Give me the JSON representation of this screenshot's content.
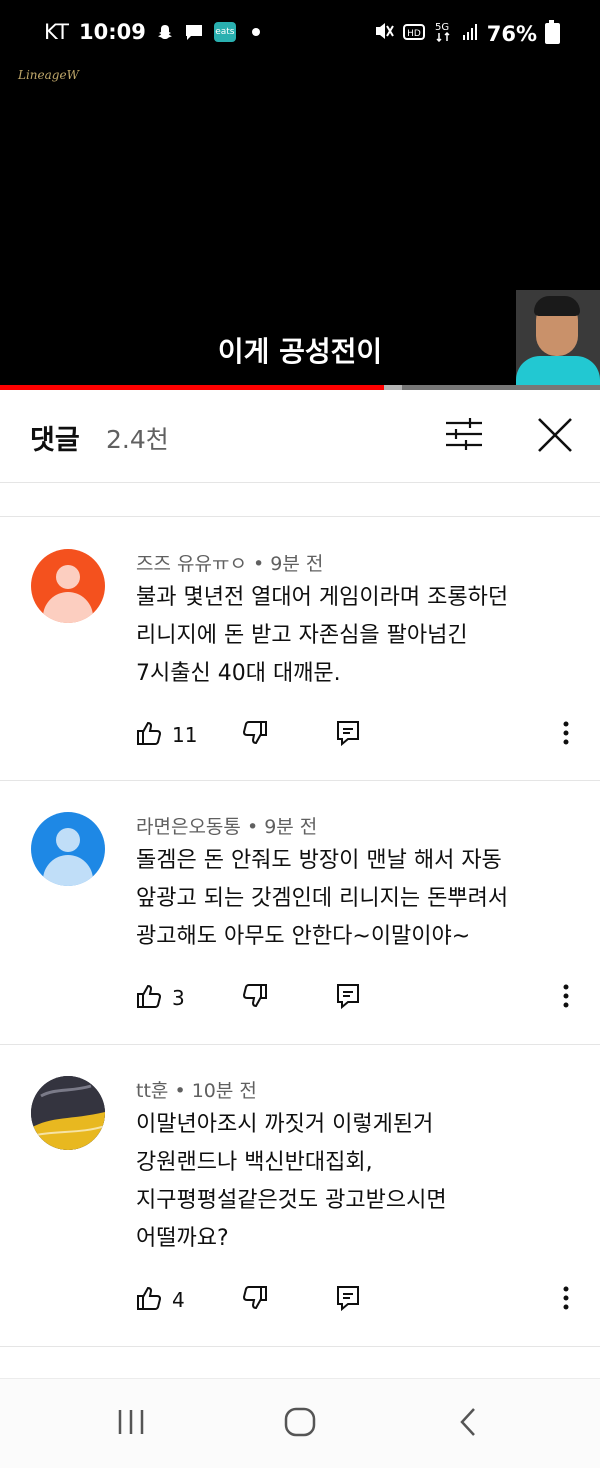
{
  "status_bar": {
    "carrier": "KT",
    "time": "10:09",
    "eats_badge": "eats",
    "battery": "76%"
  },
  "video": {
    "logo": "LineageW",
    "subtitle": "이게 공성전이",
    "progress_percent": 64,
    "buffered_percent": 3
  },
  "comments_header": {
    "title": "댓글",
    "count": "2.4천"
  },
  "comments": [
    {
      "author": "즈즈 유유ㅠㅇ",
      "time": "9분 전",
      "lines": [
        "불과 몇년전 열대어 게임이라며 조롱하던",
        "리니지에 돈 받고 자존심을 팔아넘긴",
        "7시출신 40대 대깨문."
      ],
      "likes": "11",
      "avatar_color": "#f4511e"
    },
    {
      "author": "라면은오동통",
      "time": "9분 전",
      "lines": [
        "돌겜은 돈 안줘도 방장이 맨날 해서 자동",
        "앞광고 되는 갓겜인데 리니지는 돈뿌려서",
        "광고해도 아무도 안한다~이말이야~"
      ],
      "likes": "3",
      "avatar_color": "#1e88e5"
    },
    {
      "author": "tt훈",
      "time": "10분 전",
      "lines": [
        "이말년아조시 까짓거 이렇게된거",
        "강원랜드나 백신반대집회,",
        "지구평평설같은것도 광고받으시면",
        "어떨까요?"
      ],
      "likes": "4",
      "avatar_color": "#2b2b3a"
    }
  ],
  "meta_separator": "•"
}
